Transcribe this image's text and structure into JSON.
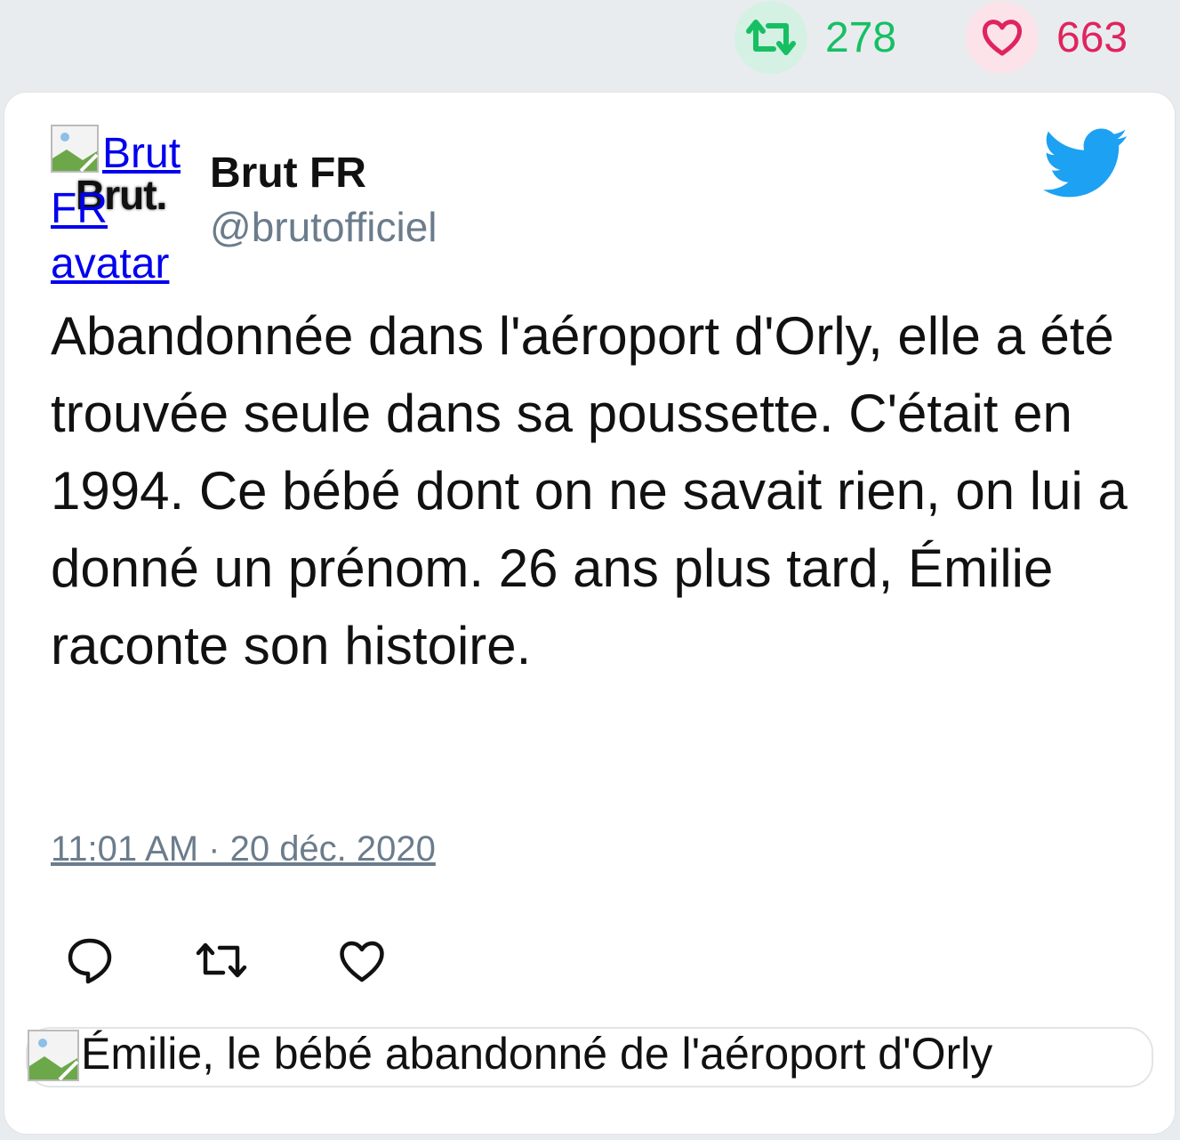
{
  "top_stats": {
    "retweet_count": "278",
    "like_count": "663",
    "retweet_icon": "retweet-icon",
    "like_icon": "heart-icon"
  },
  "tweet": {
    "author": {
      "avatar_alt": "Brut FR avatar",
      "avatar_logo_text": "Brut.",
      "name": "Brut FR",
      "handle": "@brutofficiel"
    },
    "text": "Abandonnée dans l'aéroport d'Orly, elle a été trouvée seule dans sa poussette. C'était en 1994. Ce bébé dont on ne savait rien, on lui a donné un prénom. 26 ans plus tard, Émilie raconte son histoire.",
    "timestamp": "11:01 AM · 20 déc. 2020",
    "actions": [
      "reply-icon",
      "retweet-icon",
      "heart-icon"
    ],
    "media_alt": "Émilie, le bébé abandonné de l'aéroport d'Orly"
  },
  "colors": {
    "retweet_green": "#17bf63",
    "like_red": "#e0245e",
    "twitter_blue": "#1da1f2",
    "muted_gray": "#6b7c8c",
    "link_blue": "#0000ee"
  }
}
